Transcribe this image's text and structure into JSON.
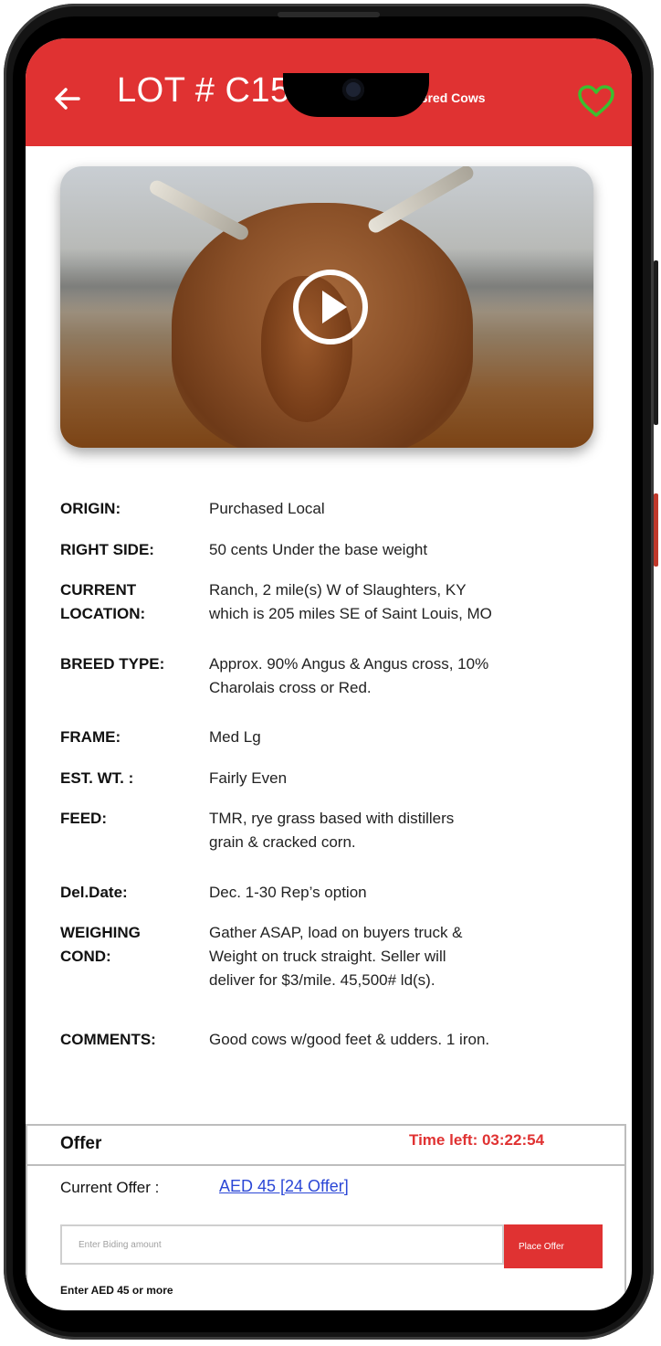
{
  "header": {
    "lot_title": "LOT # C1553",
    "subtitle": "35, Male Bred Cows",
    "back_icon": "arrow-left-icon",
    "favorite_icon": "heart-outline-icon",
    "accent_color": "#e03232",
    "favorite_color": "#3bbf2f"
  },
  "media": {
    "play_icon": "play-circle-icon"
  },
  "details": [
    {
      "label": "ORIGIN:",
      "value": "Purchased Local"
    },
    {
      "label": "RIGHT SIDE:",
      "value": "50 cents Under the base weight"
    },
    {
      "label": "CURRENT\nLOCATION:",
      "value": "Ranch, 2 mile(s) W of Slaughters, KY\nwhich is 205 miles SE of Saint Louis, MO"
    },
    {
      "label": "BREED TYPE:",
      "value": "Approx. 90% Angus & Angus cross, 10%\nCharolais cross or Red."
    },
    {
      "label": "FRAME:",
      "value": "Med Lg"
    },
    {
      "label": "EST. WT. :",
      "value": "Fairly Even"
    },
    {
      "label": "FEED:",
      "value": "TMR, rye grass based with distillers\ngrain & cracked corn."
    },
    {
      "label": "Del.Date:",
      "value": "Dec. 1-30 Rep’s option"
    },
    {
      "label": "WEIGHING\nCOND:",
      "value": "Gather ASAP, load on buyers truck &\n Weight on truck straight. Seller will\n deliver for $3/mile. 45,500# ld(s)."
    },
    {
      "label": "COMMENTS:",
      "value": "Good cows w/good feet & udders. 1 iron."
    }
  ],
  "offer": {
    "title": "Offer",
    "time_left": "Time left: 03:22:54",
    "current_label": "Current Offer :",
    "current_value": "AED 45 [24 Offer]",
    "input_placeholder": "Enter Biding amount",
    "button_label": "Place Offer",
    "hint": "Enter AED 45 or more"
  }
}
